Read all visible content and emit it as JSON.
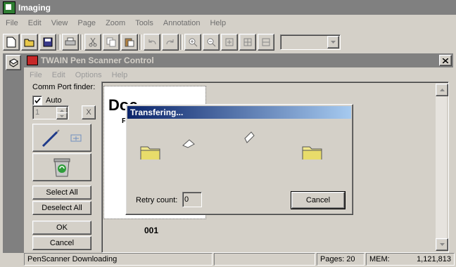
{
  "app": {
    "title": "Imaging",
    "menu": [
      "File",
      "Edit",
      "View",
      "Page",
      "Zoom",
      "Tools",
      "Annotation",
      "Help"
    ],
    "toolbar_icons": [
      "new-icon",
      "open-icon",
      "save-icon",
      "print-icon",
      "cut-icon",
      "copy-icon",
      "paste-icon",
      "undo-icon",
      "redo-icon",
      "zoom-in-icon",
      "zoom-out-icon",
      "fit-page-icon",
      "fit-width-icon",
      "fit-height-icon"
    ],
    "zoom_value": ""
  },
  "child": {
    "title": "TWAIN Pen Scanner Control",
    "close_label": "x",
    "menu": [
      "File",
      "Edit",
      "Options",
      "Help"
    ],
    "comm_port_label": "Comm Port finder:",
    "auto_label": "Auto",
    "auto_checked": true,
    "port_value": "1",
    "clear_label": "X",
    "select_all": "Select All",
    "deselect_all": "Deselect All",
    "ok": "OK",
    "cancel": "Cancel",
    "thumbnail_heading": "Doc",
    "thumbnail_sub": "F",
    "page_label": "001"
  },
  "dialog": {
    "title": "Transfering...",
    "retry_label": "Retry count:",
    "retry_value": "0",
    "cancel": "Cancel"
  },
  "status": {
    "message": "PenScanner Downloading",
    "pages": "Pages:  20",
    "mem_label": "MEM:",
    "mem_value": "1,121,813"
  },
  "colors": {
    "titlebar_active_start": "#0a246a",
    "titlebar_active_end": "#a6caf0",
    "titlebar_inactive": "#808080",
    "face": "#d4d0c8",
    "folder": "#f0e68c"
  }
}
